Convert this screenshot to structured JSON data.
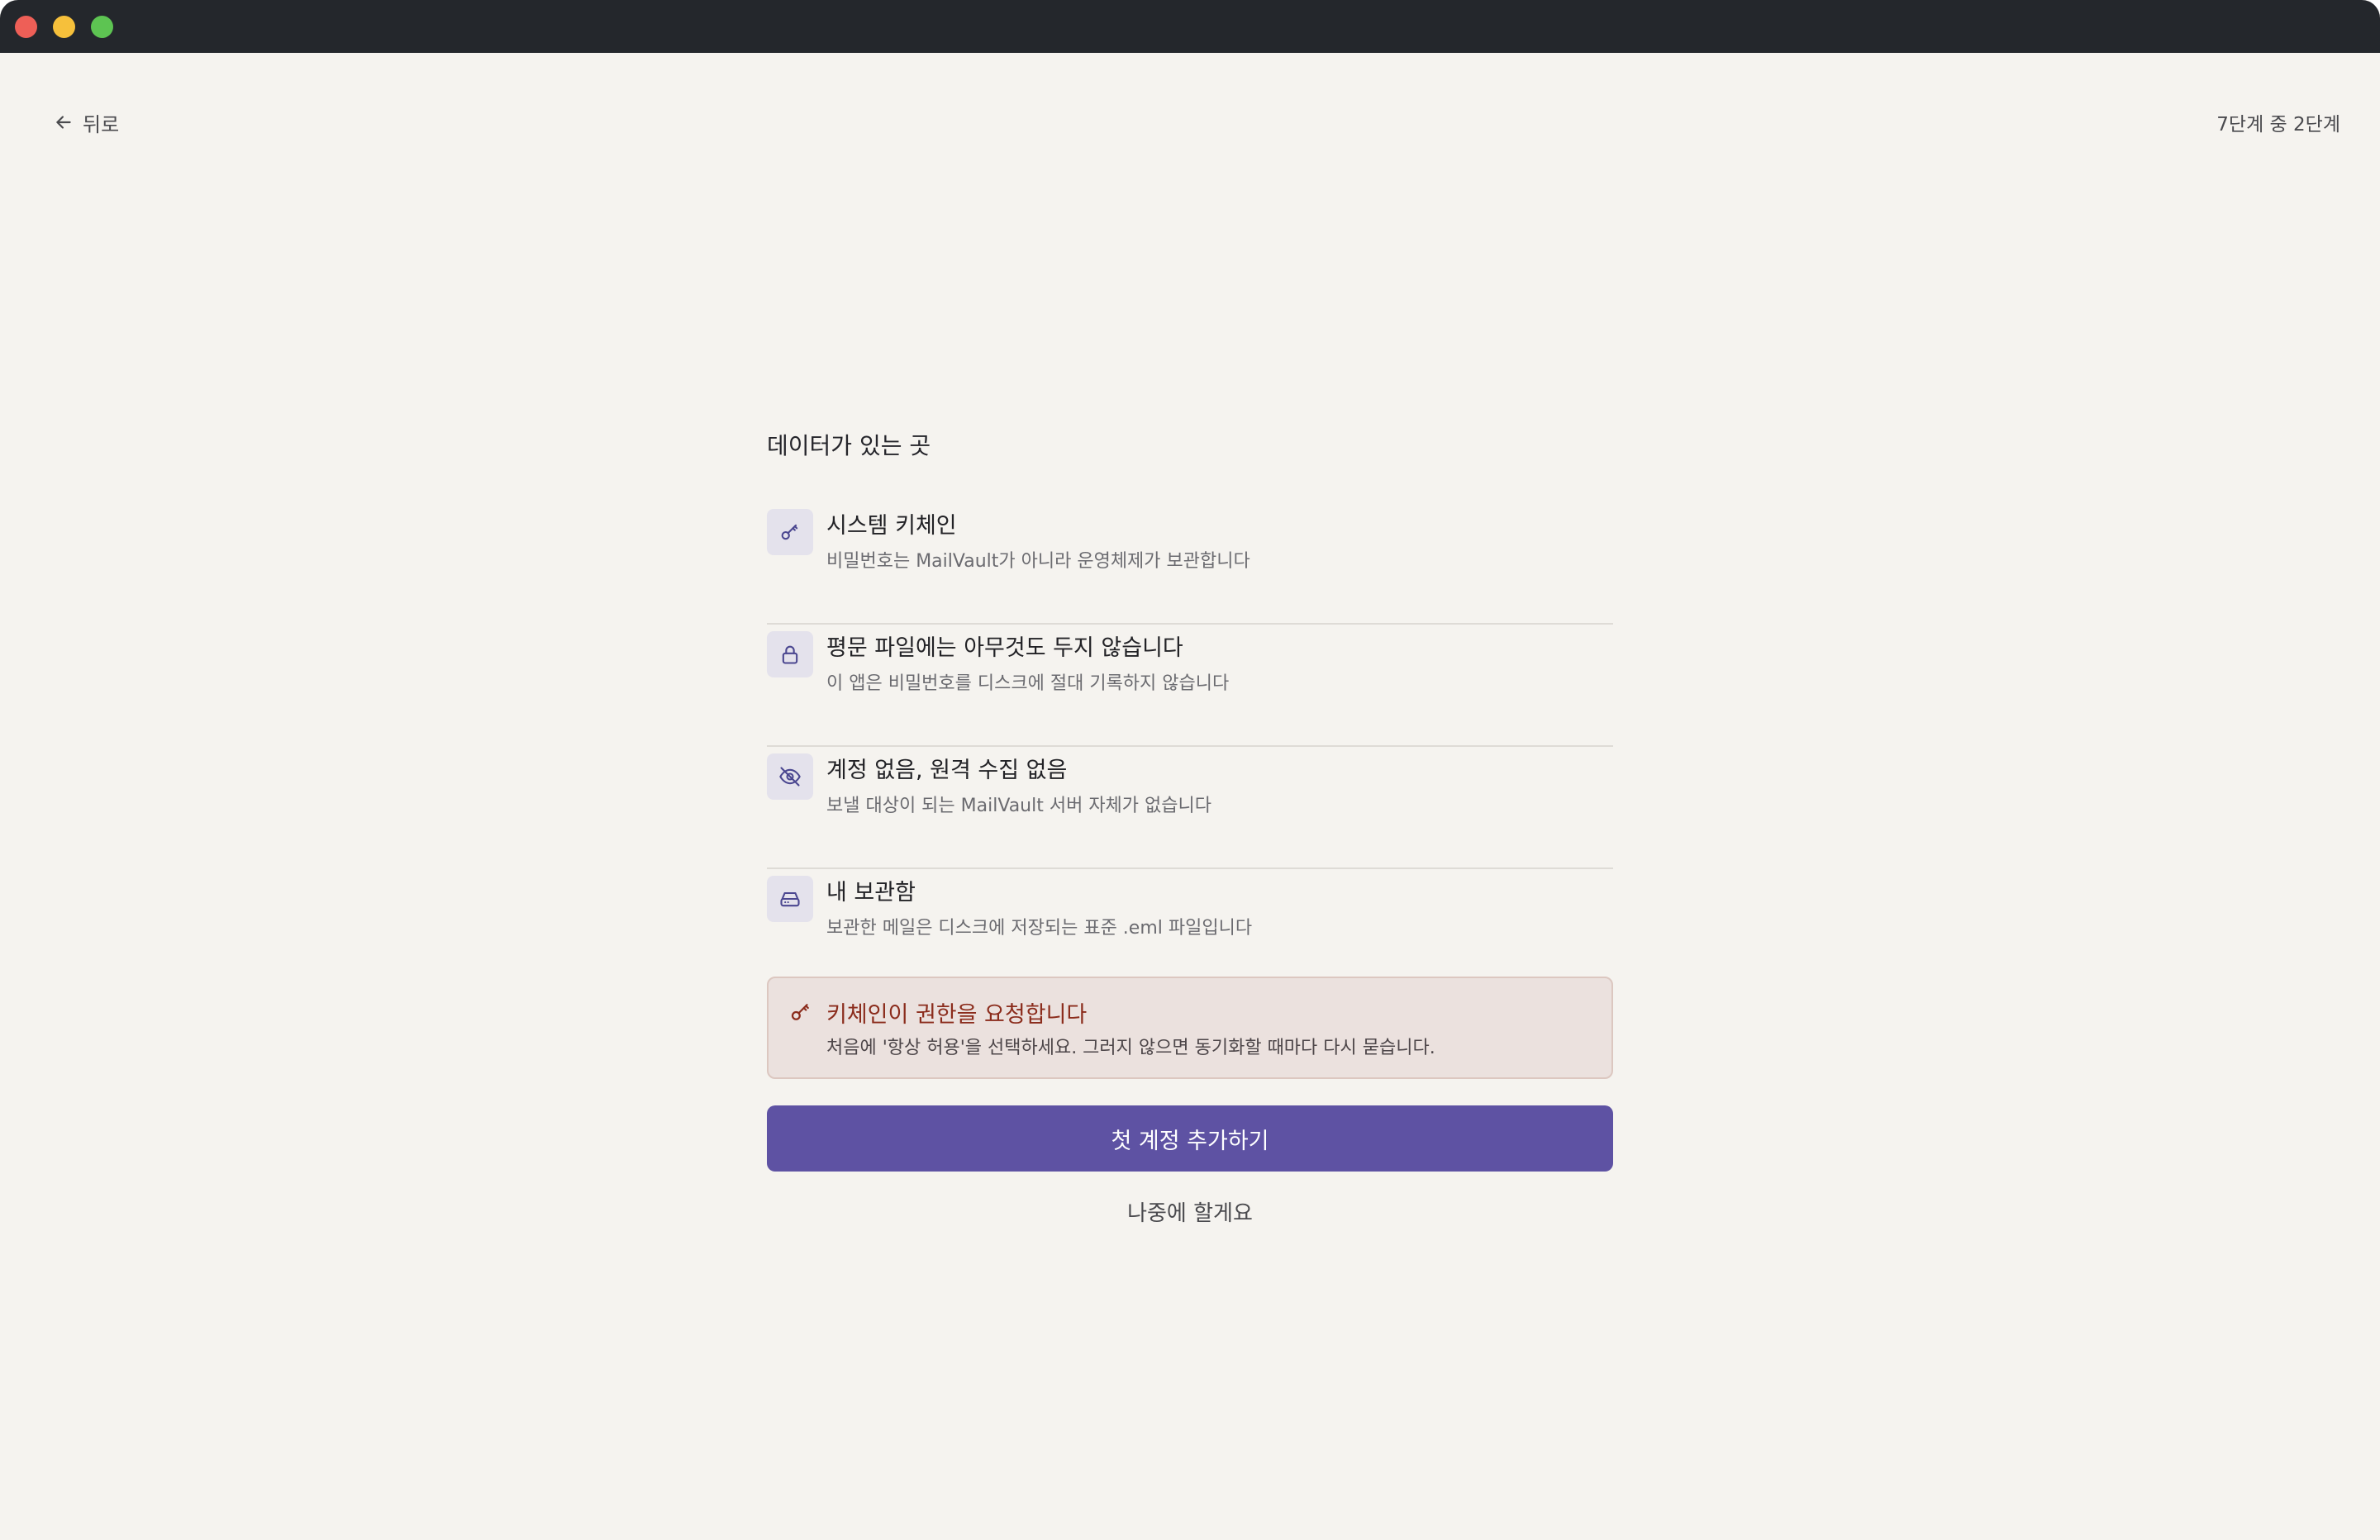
{
  "colors": {
    "titlebar": "#24272c",
    "background": "#f5f3ef",
    "accent": "#5e52a3",
    "icon_tile": "#e4e2ec",
    "notice_bg": "#ebe1de",
    "notice_title": "#8b2c1c"
  },
  "window": {
    "controls": [
      "close",
      "minimize",
      "zoom"
    ]
  },
  "nav": {
    "back_label": "뒤로",
    "step_label": "7단계 중 2단계",
    "back_icon": "arrow-left-icon"
  },
  "section": {
    "title": "데이터가 있는 곳"
  },
  "items": [
    {
      "icon": "key-icon",
      "title": "시스템 키체인",
      "desc": "비밀번호는 MailVault가 아니라 운영체제가 보관합니다"
    },
    {
      "icon": "lock-icon",
      "title": "평문 파일에는 아무것도 두지 않습니다",
      "desc": "이 앱은 비밀번호를 디스크에 절대 기록하지 않습니다"
    },
    {
      "icon": "eye-off-icon",
      "title": "계정 없음, 원격 수집 없음",
      "desc": "보낼 대상이 되는 MailVault 서버 자체가 없습니다"
    },
    {
      "icon": "hard-drive-icon",
      "title": "내 보관함",
      "desc": "보관한 메일은 디스크에 저장되는 표준 .eml 파일입니다"
    }
  ],
  "notice": {
    "icon": "key-icon",
    "title": "키체인이 권한을 요청합니다",
    "desc": "처음에 '항상 허용'을 선택하세요. 그러지 않으면 동기화할 때마다 다시 묻습니다."
  },
  "actions": {
    "primary": "첫 계정 추가하기",
    "secondary": "나중에 할게요"
  }
}
